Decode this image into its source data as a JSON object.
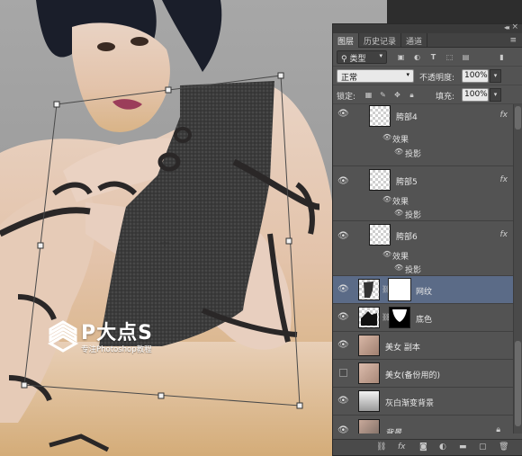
{
  "watermark": {
    "brand": "P大点S",
    "tagline": "专注Photoshop教程"
  },
  "panel": {
    "tabs": [
      {
        "label": "图层",
        "active": true
      },
      {
        "label": "历史记录",
        "active": false
      },
      {
        "label": "通道",
        "active": false
      }
    ],
    "filter": {
      "kind_label": "类型"
    },
    "blend_mode": "正常",
    "opacity_label": "不透明度:",
    "opacity_value": "100%",
    "lock_label": "锁定:",
    "fill_label": "填充:",
    "fill_value": "100%",
    "layers": [
      {
        "name": "胯部4",
        "visible": true,
        "fx": "fx",
        "effects_label": "效果",
        "effect": "投影"
      },
      {
        "name": "胯部5",
        "visible": true,
        "fx": "fx",
        "effects_label": "效果",
        "effect": "投影"
      },
      {
        "name": "胯部6",
        "visible": true,
        "fx": "fx",
        "effects_label": "效果",
        "effect": "投影"
      },
      {
        "name": "网纹",
        "visible": true,
        "selected": true
      },
      {
        "name": "底色",
        "visible": true
      },
      {
        "name": "美女 副本",
        "visible": true
      },
      {
        "name": "美女(备份用的)",
        "visible": false
      },
      {
        "name": "灰白渐变背景",
        "visible": true
      },
      {
        "name": "背景",
        "visible": true,
        "locked": true
      }
    ],
    "footer_icons": [
      "link-icon",
      "fx-icon",
      "mask-icon",
      "adjustment-icon",
      "folder-icon",
      "new-layer-icon",
      "trash-icon"
    ]
  },
  "colors": {
    "selection": "#5b6b87",
    "panel_bg": "#535353",
    "canvas_bg": "#9c9c9c"
  }
}
